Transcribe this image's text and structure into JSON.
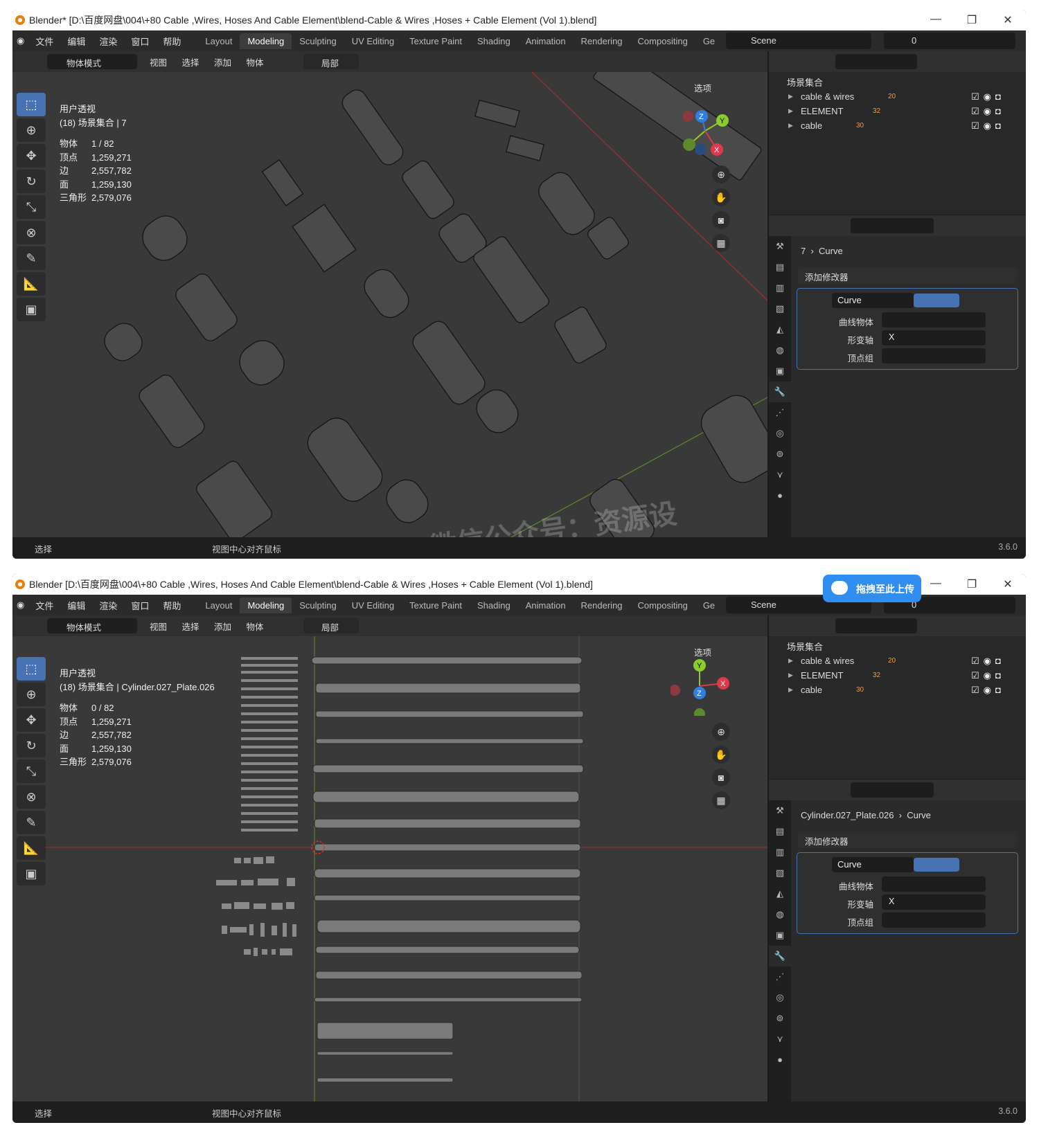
{
  "app": {
    "menu": [
      "文件",
      "编辑",
      "渲染",
      "窗口",
      "帮助"
    ],
    "workspaces": [
      "Layout",
      "Modeling",
      "Sculpting",
      "UV Editing",
      "Texture Paint",
      "Shading",
      "Animation",
      "Rendering",
      "Compositing",
      "Ge"
    ],
    "active_workspace": "Modeling",
    "scene": "Scene",
    "view_layer": "0",
    "version": "3.6.0"
  },
  "viewport_header": {
    "mode": "物体模式",
    "menu": [
      "视图",
      "选择",
      "添加",
      "物体"
    ],
    "orientation": "局部",
    "options": "选项"
  },
  "outliner": {
    "root": "场景集合",
    "collections": [
      {
        "name": "cable & wires",
        "count": "20"
      },
      {
        "name": "ELEMENT",
        "count": "32"
      },
      {
        "name": "cable",
        "count": "30"
      }
    ]
  },
  "modifier": {
    "add_label": "添加修改器",
    "name": "Curve",
    "field_curve_object": "曲线物体",
    "field_deform_axis": "形变轴",
    "deform_axis_value": "X",
    "field_vertex_group": "顶点组"
  },
  "statusbar": {
    "select": "选择",
    "center_view": "视图中心对齐鼠标"
  },
  "shot1": {
    "window_title": "Blender* [D:\\百度网盘\\004\\+80 Cable ,Wires, Hoses And Cable Element\\blend-Cable & Wires ,Hoses + Cable Element (Vol 1).blend]",
    "view_name": "用户透视",
    "collection_line": "(18) 场景集合 | 7",
    "stats": [
      {
        "k": "物体",
        "v": "1 / 82"
      },
      {
        "k": "顶点",
        "v": "1,259,271"
      },
      {
        "k": "边",
        "v": "2,557,782"
      },
      {
        "k": "面",
        "v": "1,259,130"
      },
      {
        "k": "三角形",
        "v": "2,579,076"
      }
    ],
    "breadcrumb_object": "7",
    "breadcrumb_data": "Curve"
  },
  "shot2": {
    "window_title": "Blender [D:\\百度网盘\\004\\+80 Cable ,Wires, Hoses And Cable Element\\blend-Cable & Wires ,Hoses + Cable Element (Vol 1).blend]",
    "view_name": "用户透视",
    "collection_line": "(18) 场景集合 | Cylinder.027_Plate.026",
    "stats": [
      {
        "k": "物体",
        "v": "0 / 82"
      },
      {
        "k": "顶点",
        "v": "1,259,271"
      },
      {
        "k": "边",
        "v": "2,557,782"
      },
      {
        "k": "面",
        "v": "1,259,130"
      },
      {
        "k": "三角形",
        "v": "2,579,076"
      }
    ],
    "breadcrumb_object": "Cylinder.027_Plate.026",
    "breadcrumb_data": "Curve",
    "upload_button": "拖拽至此上传"
  },
  "watermark": "微信公众号：资源设",
  "colors": {
    "accent": "#4772b3",
    "axis_x": "#e0394a",
    "axis_y": "#8ccd2a",
    "axis_z": "#2f7fe0",
    "orange": "#e87d0d"
  }
}
